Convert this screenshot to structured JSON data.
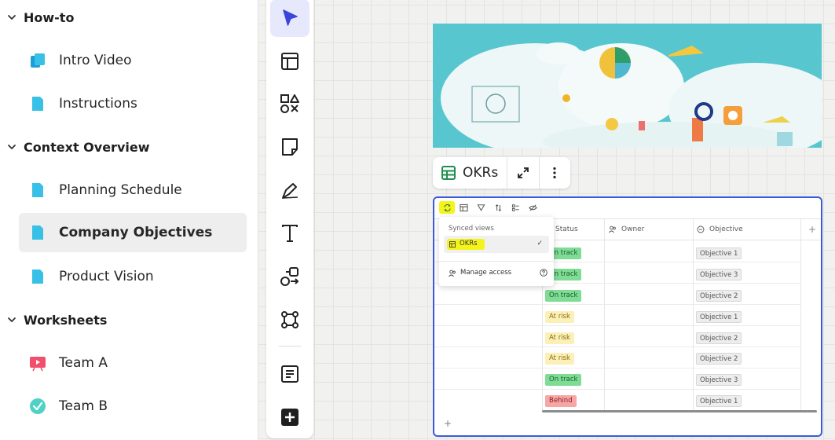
{
  "sidebar": {
    "sections": [
      {
        "title": "How-to",
        "items": [
          {
            "label": "Intro Video",
            "icon": "doc-stack-icon"
          },
          {
            "label": "Instructions",
            "icon": "doc-icon"
          }
        ]
      },
      {
        "title": "Context Overview",
        "items": [
          {
            "label": "Planning Schedule",
            "icon": "doc-icon"
          },
          {
            "label": "Company Objectives",
            "icon": "doc-icon",
            "selected": true
          },
          {
            "label": "Product Vision",
            "icon": "doc-icon"
          }
        ]
      },
      {
        "title": "Worksheets",
        "items": [
          {
            "label": "Team A",
            "icon": "video-board-icon"
          },
          {
            "label": "Team B",
            "icon": "check-circle-icon"
          }
        ]
      }
    ]
  },
  "toolrail": {
    "tools": [
      "select-arrow-icon",
      "template-icon",
      "shapes-icon",
      "sticky-note-icon",
      "pen-icon",
      "text-icon",
      "connector-icon",
      "frame-icon",
      "doc-list-icon",
      "add-icon"
    ],
    "active": "select-arrow-icon"
  },
  "widget_toolbar": {
    "title": "OKRs"
  },
  "table": {
    "columns": {
      "status": "Status",
      "owner": "Owner",
      "objective": "Objective"
    },
    "add_column": "+",
    "add_row": "+",
    "rows": [
      {
        "status": "On track",
        "objective": "Objective 1"
      },
      {
        "status": "On track",
        "objective": "Objective 3"
      },
      {
        "status": "On track",
        "objective": "Objective 2"
      },
      {
        "status": "At risk",
        "objective": "Objective 1"
      },
      {
        "status": "At risk",
        "objective": "Objective 2"
      },
      {
        "status": "At risk",
        "objective": "Objective 2"
      },
      {
        "status": "On track",
        "objective": "Objective 3"
      },
      {
        "status": "Behind",
        "objective": "Objective 1"
      }
    ]
  },
  "dropdown": {
    "header": "Synced views",
    "item": "OKRs",
    "manage": "Manage access"
  },
  "colors": {
    "accent": "#3b5bdb",
    "highlight": "#f4f41c",
    "on_track": "#7fdc95",
    "at_risk": "#fbf0b8",
    "behind": "#f7a6a6",
    "doc_icon": "#38c0e6"
  }
}
